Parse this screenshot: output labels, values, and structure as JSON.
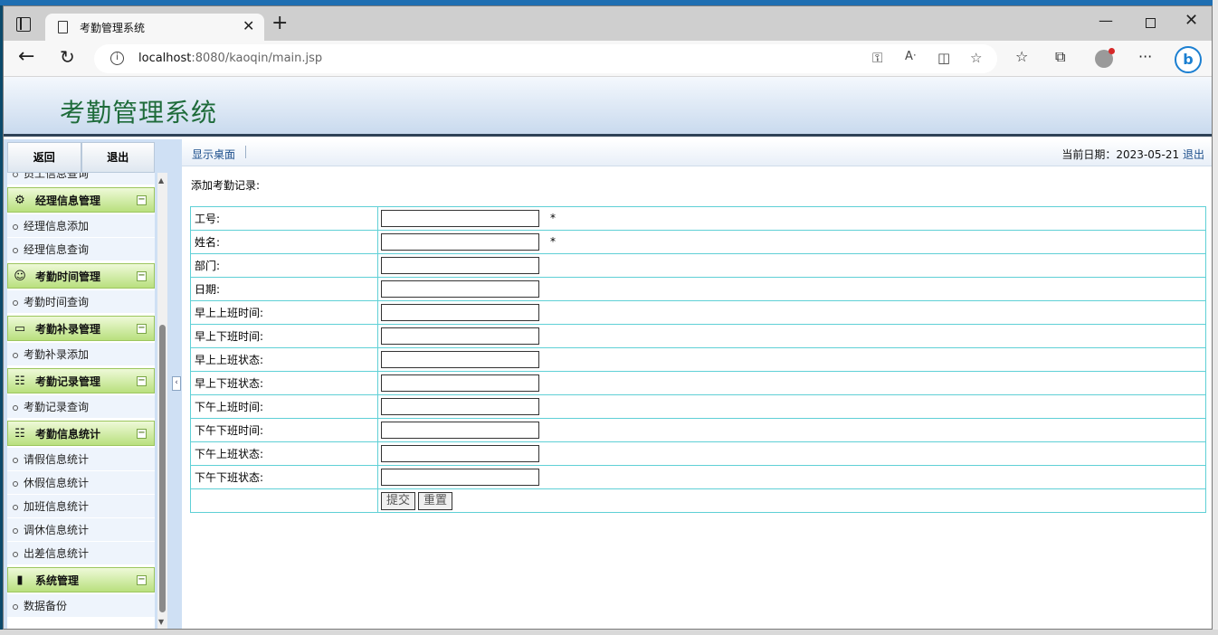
{
  "browser": {
    "tab_title": "考勤管理系统",
    "url_host": "localhost",
    "url_rest": ":8080/kaoqin/main.jsp"
  },
  "header": {
    "title": "考勤管理系统"
  },
  "sidebar": {
    "back": "返回",
    "exit": "退出",
    "partial_item": "员工信息查询",
    "groups": [
      {
        "title": "经理信息管理",
        "icon": "gear-icon",
        "items": [
          "经理信息添加",
          "经理信息查询"
        ]
      },
      {
        "title": "考勤时间管理",
        "icon": "user-icon",
        "items": [
          "考勤时间查询"
        ]
      },
      {
        "title": "考勤补录管理",
        "icon": "folder-icon",
        "items": [
          "考勤补录添加"
        ]
      },
      {
        "title": "考勤记录管理",
        "icon": "clipboard-icon",
        "items": [
          "考勤记录查询"
        ]
      },
      {
        "title": "考勤信息统计",
        "icon": "clipboard-icon",
        "items": [
          "请假信息统计",
          "休假信息统计",
          "加班信息统计",
          "调休信息统计",
          "出差信息统计"
        ]
      },
      {
        "title": "系统管理",
        "icon": "bar-chart-icon",
        "items": [
          "数据备份"
        ]
      }
    ]
  },
  "main": {
    "show_desktop": "显示桌面",
    "date_label": "当前日期：",
    "date": "2023-05-21",
    "logout": "退出",
    "form_title": "添加考勤记录:",
    "fields": [
      "工号:",
      "姓名:",
      "部门:",
      "日期:",
      "早上上班时间:",
      "早上下班时间:",
      "早上上班状态:",
      "早上下班状态:",
      "下午上班时间:",
      "下午下班时间:",
      "下午上班状态:",
      "下午下班状态:"
    ],
    "required_mark": "*",
    "submit": "提交",
    "reset": "重置"
  }
}
